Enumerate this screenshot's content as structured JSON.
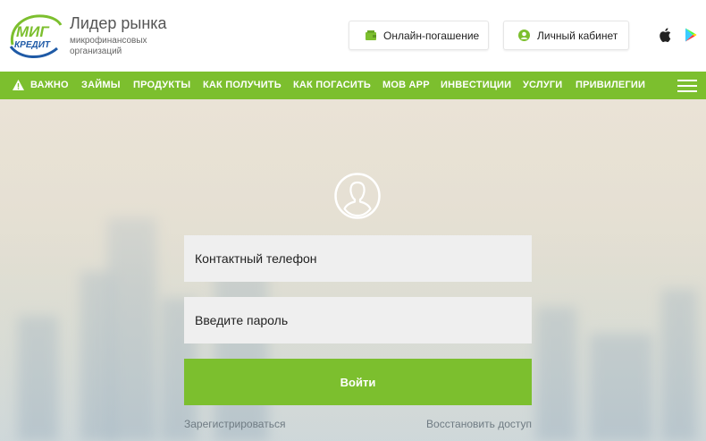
{
  "logo": {
    "line1": "МИГ",
    "line2": "КРЕДИТ"
  },
  "tagline": {
    "title": "Лидер рынка",
    "subtitle": "микрофинансовых организаций"
  },
  "header_buttons": {
    "online_repayment": "Онлайн-погашение",
    "personal_cabinet": "Личный кабинет"
  },
  "nav": {
    "items": [
      "ВАЖНО",
      "ЗАЙМЫ",
      "ПРОДУКТЫ",
      "КАК ПОЛУЧИТЬ",
      "КАК ПОГАСИТЬ",
      "МОВ APP",
      "ИНВЕСТИЦИИ",
      "УСЛУГИ",
      "ПРИВИЛЕГИИ"
    ]
  },
  "login": {
    "phone_placeholder": "Контактный телефон",
    "password_placeholder": "Введите пароль",
    "submit_label": "Войти",
    "register_link": "Зарегистрироваться",
    "restore_link": "Восстановить доступ"
  },
  "colors": {
    "brand_green": "#7cbf2e",
    "brand_blue": "#1f5aa6"
  },
  "icons": [
    "wallet-icon",
    "user-circle-icon",
    "apple-icon",
    "google-play-icon",
    "warning-icon",
    "hamburger-menu-icon",
    "user-avatar-icon"
  ]
}
